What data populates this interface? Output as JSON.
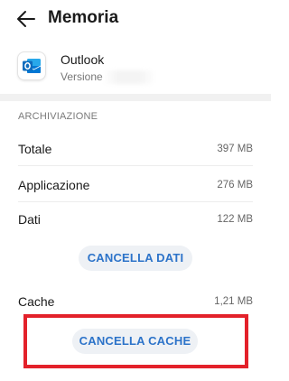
{
  "header": {
    "title": "Memoria",
    "back_icon": "arrow-left-icon"
  },
  "app": {
    "name": "Outlook",
    "version_label": "Versione",
    "icon": "outlook-icon",
    "brand_color": "#0f6cbd"
  },
  "storage": {
    "section_title": "ARCHIVIAZIONE",
    "rows": [
      {
        "label": "Totale",
        "value": "397 MB"
      },
      {
        "label": "Applicazione",
        "value": "276 MB"
      },
      {
        "label": "Dati",
        "value": "122 MB"
      }
    ],
    "clear_data_label": "CANCELLA DATI"
  },
  "cache": {
    "label": "Cache",
    "value": "1,21 MB",
    "clear_cache_label": "CANCELLA CACHE"
  },
  "colors": {
    "accent": "#2c73c9",
    "highlight_border": "#e3212a"
  }
}
